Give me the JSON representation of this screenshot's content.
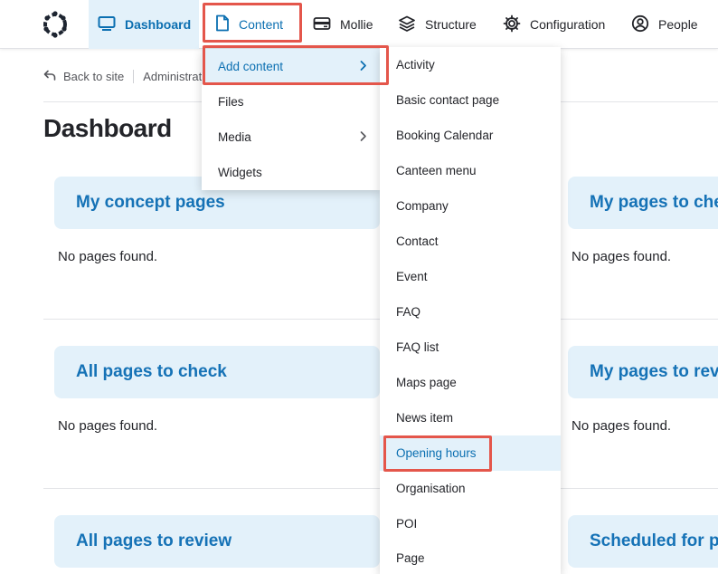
{
  "colors": {
    "accent": "#0b6fb1",
    "block_bg": "#e3f1fa",
    "highlight_border": "#e4564b"
  },
  "toolbar": {
    "logo_icon": "droplet-logo",
    "items": [
      {
        "label": "Dashboard",
        "icon": "monitor-icon",
        "state": "active"
      },
      {
        "label": "Content",
        "icon": "document-icon",
        "state": "open"
      },
      {
        "label": "Mollie",
        "icon": "card-icon"
      },
      {
        "label": "Structure",
        "icon": "layers-icon"
      },
      {
        "label": "Configuration",
        "icon": "gear-icon"
      },
      {
        "label": "People",
        "icon": "person-icon"
      }
    ]
  },
  "breadcrumb": {
    "back_label": "Back to site",
    "admin_label": "Administration"
  },
  "page": {
    "title": "Dashboard"
  },
  "blocks": {
    "left": [
      {
        "title": "My concept pages",
        "empty": "No pages found."
      },
      {
        "title": "All pages to check",
        "empty": "No pages found."
      },
      {
        "title": "All pages to review"
      }
    ],
    "right": [
      {
        "title": "My pages to check",
        "empty": "No pages found."
      },
      {
        "title": "My pages to review",
        "empty": "No pages found."
      },
      {
        "title": "Scheduled for publishing"
      }
    ]
  },
  "content_menu": {
    "items": [
      {
        "label": "Add content",
        "has_submenu": true,
        "state": "active"
      },
      {
        "label": "Files"
      },
      {
        "label": "Media",
        "has_submenu": true
      },
      {
        "label": "Widgets"
      }
    ]
  },
  "add_content_menu": {
    "items": [
      {
        "label": "Activity"
      },
      {
        "label": "Basic contact page"
      },
      {
        "label": "Booking Calendar"
      },
      {
        "label": "Canteen menu"
      },
      {
        "label": "Company"
      },
      {
        "label": "Contact"
      },
      {
        "label": "Event"
      },
      {
        "label": "FAQ"
      },
      {
        "label": "FAQ list"
      },
      {
        "label": "Maps page"
      },
      {
        "label": "News item"
      },
      {
        "label": "Opening hours",
        "state": "active"
      },
      {
        "label": "Organisation"
      },
      {
        "label": "POI"
      },
      {
        "label": "Page"
      }
    ]
  }
}
